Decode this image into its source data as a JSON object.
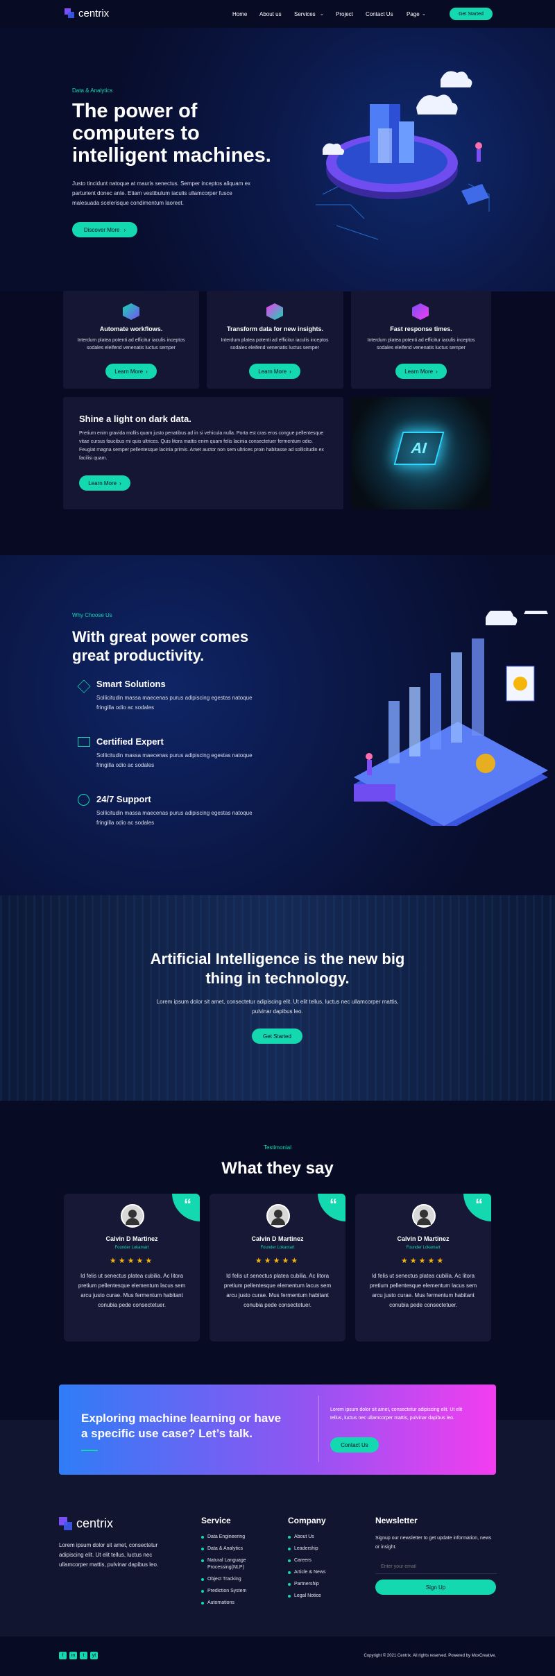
{
  "header": {
    "brand": "centrix",
    "nav": [
      "Home",
      "About us",
      "Services",
      "Project",
      "Contact Us",
      "Page"
    ],
    "cta": "Get Started"
  },
  "hero": {
    "eyebrow": "Data & Analytics",
    "title": "The power of computers to intelligent machines.",
    "text": "Justo tincidunt natoque at mauris senectus. Semper inceptos aliquam ex parturient donec ante. Etiam vestibulum iaculis ullamcorper fusce malesuada scelerisque condimentum laoreet.",
    "button": "Discover More"
  },
  "services": [
    {
      "title": "Automate workflows.",
      "text": "Interdum platea potenti ad efficitur iaculis inceptos sodales eleifend venenatis luctus semper",
      "button": "Learn More"
    },
    {
      "title": "Transform data for new insights.",
      "text": "Interdum platea potenti ad efficitur iaculis inceptos sodales eleifend venenatis luctus semper",
      "button": "Learn More"
    },
    {
      "title": "Fast response times.",
      "text": "Interdum platea potenti ad efficitur iaculis inceptos sodales eleifend venenatis luctus semper",
      "button": "Learn More"
    }
  ],
  "spotlight": {
    "title": "Shine a light on dark data.",
    "text": "Pretium enim gravida mollis quam justo penatibus ad in si vehicula nulla. Porta est cras eros congue pellentesque vitae cursus faucibus mi quis ultrices. Quis litora mattis enim quam felis lacinia consectetuer fermentum odio. Feugiat magna semper pellentesque lacinia primis. Amet auctor non sem ultrices proin habitasse ad sollicitudin ex facilisi quam.",
    "button": "Learn More",
    "image_text": "AI"
  },
  "why": {
    "eyebrow": "Why Choose Us",
    "title": "With great power comes great productivity.",
    "features": [
      {
        "title": "Smart Solutions",
        "text": "Sollicitudin massa maecenas purus adipiscing egestas natoque fringilla odio ac sodales"
      },
      {
        "title": "Certified Expert",
        "text": "Sollicitudin massa maecenas purus adipiscing egestas natoque fringilla odio ac sodales"
      },
      {
        "title": "24/7 Support",
        "text": "Sollicitudin massa maecenas purus adipiscing egestas natoque fringilla odio ac sodales"
      }
    ]
  },
  "ai_banner": {
    "title": "Artificial Intelligence is the new big thing in technology.",
    "text": "Lorem ipsum dolor sit amet, consectetur adipiscing elit. Ut elit tellus, luctus nec ullamcorper mattis, pulvinar dapibus leo.",
    "button": "Get Started"
  },
  "testimonials": {
    "eyebrow": "Testimonial",
    "title": "What they say",
    "items": [
      {
        "name": "Calvin D Martinez",
        "role": "Founder Lokamart",
        "rating": 5,
        "text": "Id felis ut senectus platea cubilia. Ac litora pretium pellentesque elementum lacus sem arcu justo curae. Mus fermentum habitant conubia pede consectetuer."
      },
      {
        "name": "Calvin D Martinez",
        "role": "Founder Lokamart",
        "rating": 5,
        "text": "Id felis ut senectus platea cubilia. Ac litora pretium pellentesque elementum lacus sem arcu justo curae. Mus fermentum habitant conubia pede consectetuer."
      },
      {
        "name": "Calvin D Martinez",
        "role": "Founder Lokamart",
        "rating": 5,
        "text": "Id felis ut senectus platea cubilia. Ac litora pretium pellentesque elementum lacus sem arcu justo curae. Mus fermentum habitant conubia pede consectetuer."
      }
    ]
  },
  "cta": {
    "title": "Exploring machine learning or have a specific use case? Let’s talk.",
    "text": "Lorem ipsum dolor sit amet, consectetur adipiscing elit. Ut elit tellus, luctus nec ullamcorper mattis, pulvinar dapibus leo.",
    "button": "Contact Us"
  },
  "footer": {
    "brand": "centrix",
    "about": "Lorem ipsum dolor sit amet, consectetur adipiscing elit. Ut elit tellus, luctus nec ullamcorper mattis, pulvinar dapibus leo.",
    "service_title": "Service",
    "service_links": [
      "Data Engineering",
      "Data & Analytics",
      "Natural Language Processing(NLP)",
      "Object Tracking",
      "Prediction System",
      "Automations"
    ],
    "company_title": "Company",
    "company_links": [
      "About Us",
      "Leadership",
      "Careers",
      "Article & News",
      "Partnership",
      "Legal Notice"
    ],
    "newsletter_title": "Newsletter",
    "newsletter_text": "Signup our newsletter to get update information, news or insight.",
    "email_placeholder": "Enter your email",
    "signup": "Sign Up",
    "socials": [
      "f",
      "in",
      "t",
      "yt"
    ],
    "copyright": "Copyright © 2021 Centrix. All rights reserved. Powered by MoxCreative."
  },
  "colors": {
    "accent": "#13d8b0",
    "background": "#070a22",
    "card": "#141634",
    "cta_from": "#2f7df6",
    "cta_to": "#f33df0"
  }
}
